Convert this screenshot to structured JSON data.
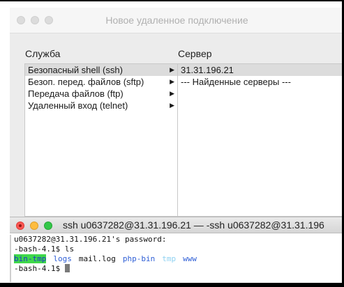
{
  "dialog": {
    "title": "Новое удаленное подключение",
    "service_header": "Служба",
    "server_header": "Сервер",
    "services": [
      {
        "label": "Безопасный shell (ssh)",
        "selected": true
      },
      {
        "label": "Безоп. перед. файлов (sftp)",
        "selected": false
      },
      {
        "label": "Передача файлов (ftp)",
        "selected": false
      },
      {
        "label": "Удаленный вход (telnet)",
        "selected": false
      }
    ],
    "servers": [
      {
        "label": "31.31.196.21",
        "selected": true
      },
      {
        "label": "--- Найденные серверы ---",
        "selected": false
      }
    ],
    "arrow_glyph": "▶"
  },
  "terminal": {
    "title": "ssh u0637282@31.31.196.21 — -ssh u0637282@31.31.196",
    "lines": {
      "password_prompt": "u0637282@31.31.196.21's password:",
      "prompt1": "-bash-4.1$ ls",
      "prompt2": "-bash-4.1$ "
    },
    "ls_output": [
      {
        "name": "bin-tmp",
        "kind": "dir-highlighted",
        "color": "#3fd84a"
      },
      {
        "name": "logs",
        "kind": "dir",
        "color": "#2f5fd6"
      },
      {
        "name": "mail.log",
        "kind": "file",
        "color": "#111111"
      },
      {
        "name": "php-bin",
        "kind": "dir",
        "color": "#2f5fd6"
      },
      {
        "name": "tmp",
        "kind": "dir-light",
        "color": "#8fd2f2"
      },
      {
        "name": "www",
        "kind": "dir",
        "color": "#2f5fd6"
      }
    ]
  }
}
